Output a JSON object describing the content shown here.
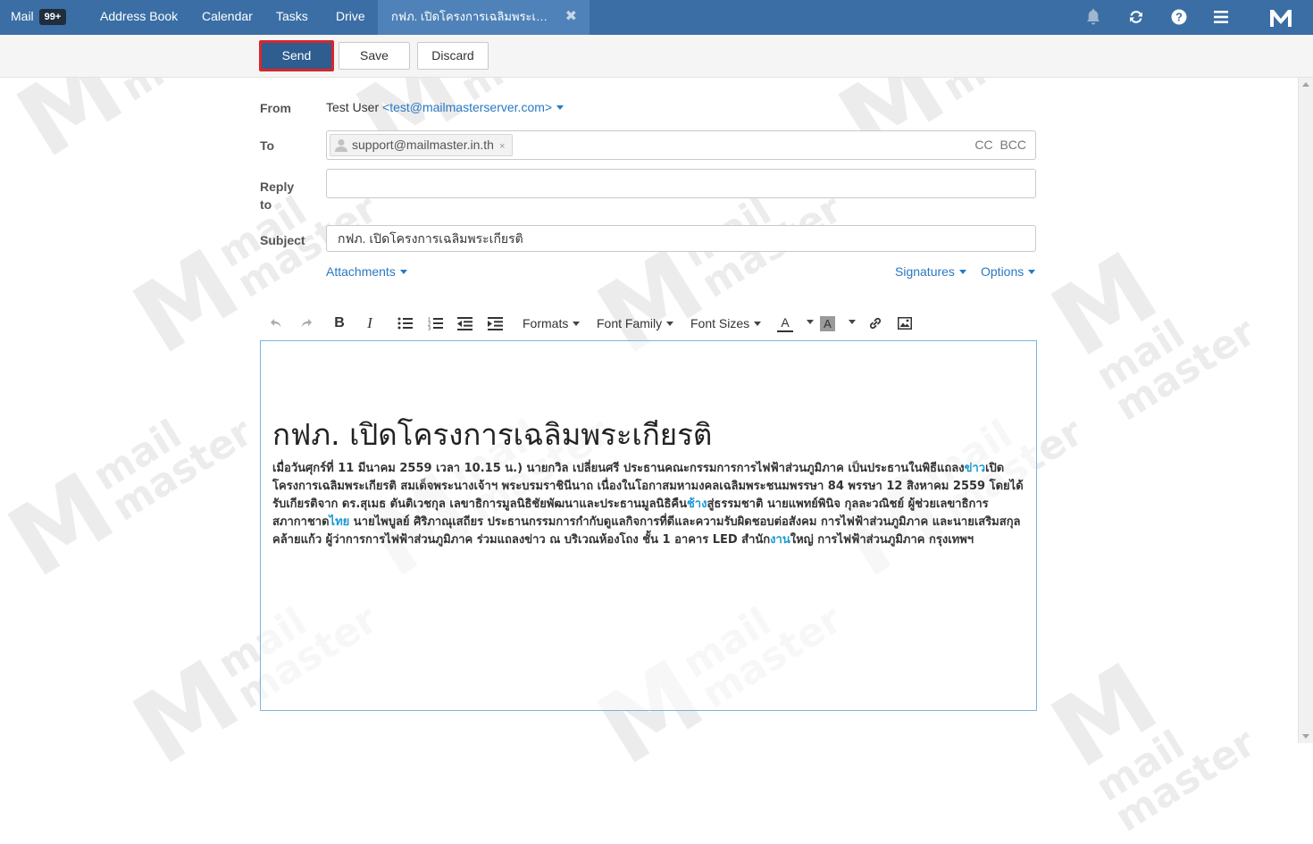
{
  "nav": {
    "mail_label": "Mail",
    "mail_badge": "99+",
    "address_book": "Address Book",
    "calendar": "Calendar",
    "tasks": "Tasks",
    "drive": "Drive",
    "active_tab": "กฟภ. เปิดโครงการเฉลิมพระเกียรติ",
    "active_tab_close": "✖",
    "icons": [
      "bell-icon",
      "refresh-icon",
      "help-icon",
      "menu-icon",
      "mailmaster-logo"
    ]
  },
  "toolbar": {
    "send": "Send",
    "save": "Save",
    "discard": "Discard"
  },
  "form": {
    "from_label": "From",
    "from_name": "Test User",
    "from_email": "<test@mailmasterserver.com>",
    "to_label": "To",
    "to_recipients": [
      "support@mailmaster.in.th"
    ],
    "to_chip_remove": "×",
    "cc_bcc": "CC BCC",
    "reply_to_label_line1": "Reply",
    "reply_to_label_line2": "to",
    "reply_to_value": "",
    "subject_label": "Subject",
    "subject_value": "กฟภ. เปิดโครงการเฉลิมพระเกียรติ",
    "attachments": "Attachments",
    "signatures": "Signatures",
    "options": "Options"
  },
  "editor_toolbar": {
    "formats": "Formats",
    "font_family": "Font Family",
    "font_sizes": "Font Sizes",
    "text_color_glyph": "A",
    "bg_color_glyph": "A"
  },
  "editor": {
    "heading": "กฟภ. เปิดโครงการเฉลิมพระเกียรติ",
    "p1": "เมื่อวันศุกร์ที่ 11 มีนาคม 2559 เวลา 10.15 น.) นายกวิล เปลี่ยนศรี ประธานคณะกรรมการการไฟฟ้าส่วนภูมิภาค เป็นประธานในพิธีแถลง",
    "kw1": "ข่าว",
    "p2": "เปิดโครงการเฉลิมพระเกียรติ สมเด็จพระนางเจ้าฯ พระบรมราชินีนาถ เนื่องในโอกาสมหามงคลเฉลิมพระชนมพรรษา 84 พรรษา 12 สิงหาคม 2559 โดยได้รับเกียรติจาก ดร.สุเมธ ตันติเวชกุล เลขาธิการมูลนิธิชัยพัฒนาและประธานมูลนิธิคืน",
    "kw2": "ช้าง",
    "p3": "สู่ธรรมชาติ นายแพทย์พินิจ กุลละวณิชย์ ผู้ช่วยเลขาธิการสภากาชาด",
    "kw3": "ไทย",
    "p4": " นายไพบูลย์ ศิริภาณุเสถียร ประธานกรรมการกำกับดูแลกิจการที่ดีและความรับผิดชอบต่อสังคม การไฟฟ้าส่วนภูมิภาค และนายเสริมสกุล คล้ายแก้ว ผู้ว่าการการไฟฟ้าส่วนภูมิภาค ร่วมแถลงข่าว ณ บริเวณห้องโถง ชั้น 1 อาคาร LED สำนัก",
    "kw4": "งาน",
    "p5": "ใหญ่ การไฟฟ้าส่วนภูมิภาค กรุงเทพฯ"
  },
  "watermark": {
    "line1": "mail",
    "line2": "master"
  },
  "colors": {
    "nav_bg": "#3a6ea5",
    "nav_active": "#4f82b8",
    "send_bg": "#2e5d8f",
    "send_outline": "#d9262c",
    "link": "#2a78c2",
    "keyword": "#1a98d5"
  }
}
